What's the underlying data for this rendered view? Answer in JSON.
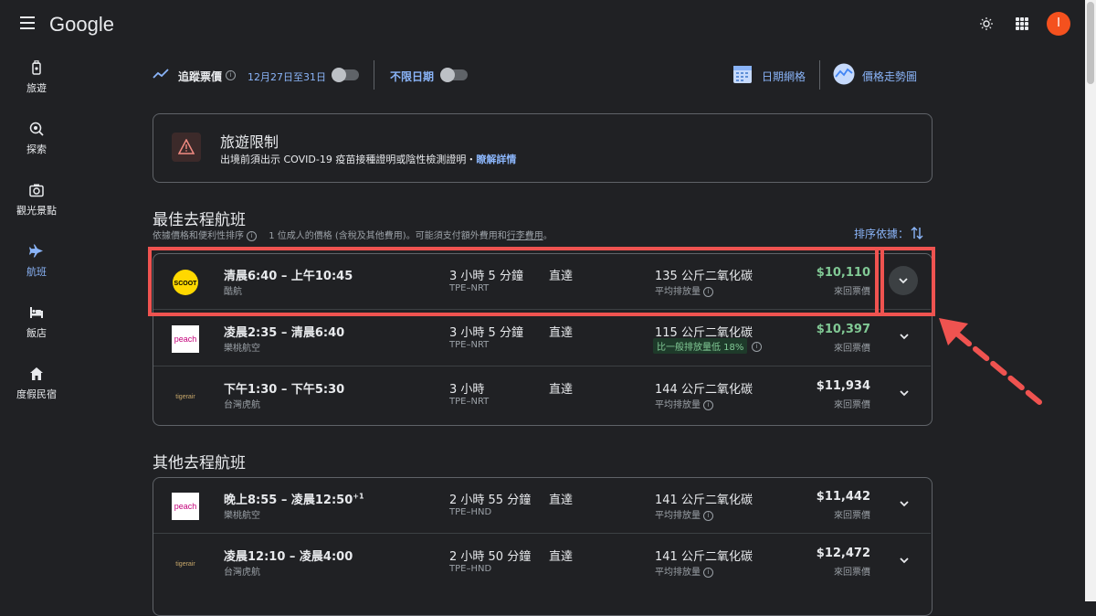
{
  "header": {
    "logo": "Google",
    "avatar_letter": "I",
    "icons": [
      "menu-icon",
      "theme-sun-icon",
      "apps-grid-icon"
    ]
  },
  "sidebar": {
    "items": [
      {
        "label": "旅遊",
        "icon": "luggage-icon",
        "active": false
      },
      {
        "label": "探索",
        "icon": "explore-icon",
        "active": false
      },
      {
        "label": "觀光景點",
        "icon": "camera-icon",
        "active": false
      },
      {
        "label": "航班",
        "icon": "plane-icon",
        "active": true
      },
      {
        "label": "飯店",
        "icon": "bed-icon",
        "active": false
      },
      {
        "label": "度假民宿",
        "icon": "home-icon",
        "active": false
      }
    ]
  },
  "tracking": {
    "track_label": "追蹤票價",
    "date_range": "12月27日至31日",
    "any_dates_label": "不限日期",
    "date_grid_label": "日期網格",
    "price_graph_label": "價格走勢圖"
  },
  "travel_restriction": {
    "title": "旅遊限制",
    "body": "出境前須出示 COVID-19 疫苗接種證明或陰性檢測證明・",
    "link": "瞭解詳情"
  },
  "best_flights": {
    "title": "最佳去程航班",
    "subtitle_a": "依據價格和便利性排序",
    "subtitle_b": "1 位成人的價格 (含稅及其他費用)。可能須支付額外費用和",
    "subtitle_link": "行李費用",
    "subtitle_end": "。",
    "sort_label": "排序依據：",
    "flights": [
      {
        "times": "清晨6:40 – 上午10:45",
        "airline": "酷航",
        "logo": "scoot",
        "duration": "3 小時 5 分鐘",
        "route": "TPE–NRT",
        "stops": "直達",
        "co2": "135 公斤二氧化碳",
        "co2_sub": "平均排放量",
        "price": "$10,110",
        "price_sub": "來回票價",
        "price_green": true
      },
      {
        "times": "凌晨2:35 – 清晨6:40",
        "airline": "樂桃航空",
        "logo": "peach",
        "duration": "3 小時 5 分鐘",
        "route": "TPE–NRT",
        "stops": "直達",
        "co2": "115 公斤二氧化碳",
        "co2_sub": "比一般排放量低 18%",
        "price": "$10,397",
        "price_sub": "來回票價",
        "price_green": true
      },
      {
        "times": "下午1:30 – 下午5:30",
        "airline": "台灣虎航",
        "logo": "tigerair",
        "duration": "3 小時",
        "route": "TPE–NRT",
        "stops": "直達",
        "co2": "144 公斤二氧化碳",
        "co2_sub": "平均排放量",
        "price": "$11,934",
        "price_sub": "來回票價",
        "price_green": false
      }
    ]
  },
  "other_flights": {
    "title": "其他去程航班",
    "flights": [
      {
        "times": "晚上8:55 – 凌晨12:50",
        "plus_day": "+1",
        "airline": "樂桃航空",
        "logo": "peach",
        "duration": "2 小時 55 分鐘",
        "route": "TPE–HND",
        "stops": "直達",
        "co2": "141 公斤二氧化碳",
        "co2_sub": "平均排放量",
        "price": "$11,442",
        "price_sub": "來回票價"
      },
      {
        "times": "凌晨12:10 – 凌晨4:00",
        "airline": "台灣虎航",
        "logo": "tigerair",
        "duration": "2 小時 50 分鐘",
        "route": "TPE–HND",
        "stops": "直達",
        "co2": "141 公斤二氧化碳",
        "co2_sub": "平均排放量",
        "price": "$12,472",
        "price_sub": "來回票價"
      }
    ]
  },
  "logo_text": {
    "scoot": "SCOOT",
    "peach": "peach",
    "tigerair": "tigerair"
  },
  "colors": {
    "background": "#202124",
    "accent_blue": "#8ab4f8",
    "price_green": "#81c995",
    "annotation_red": "#ef5350",
    "avatar": "#f4511e"
  }
}
